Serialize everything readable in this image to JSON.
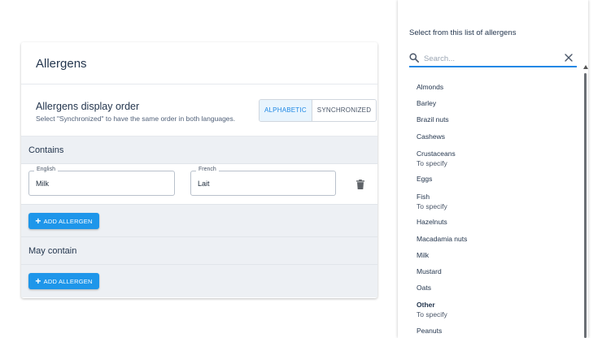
{
  "card": {
    "title": "Allergens",
    "display_order": {
      "title": "Allergens display order",
      "subtitle": "Select \"Synchronized\" to have the same order in both languages.",
      "options": [
        "ALPHABETIC",
        "SYNCHRONIZED"
      ],
      "selected": "ALPHABETIC"
    },
    "contains": {
      "label": "Contains",
      "rows": [
        {
          "en_label": "English",
          "en_value": "Milk",
          "fr_label": "French",
          "fr_value": "Lait"
        }
      ],
      "add_label": "ADD ALLERGEN"
    },
    "may_contain": {
      "label": "May contain",
      "add_label": "ADD ALLERGEN"
    }
  },
  "panel": {
    "title": "Select from this list of allergens",
    "search": {
      "placeholder": "Search...",
      "value": ""
    },
    "items": [
      {
        "name": "Almonds",
        "sub": ""
      },
      {
        "name": "Barley",
        "sub": ""
      },
      {
        "name": "Brazil nuts",
        "sub": ""
      },
      {
        "name": "Cashews",
        "sub": ""
      },
      {
        "name": "Crustaceans",
        "sub": "To specify"
      },
      {
        "name": "Eggs",
        "sub": ""
      },
      {
        "name": "Fish",
        "sub": "To specify"
      },
      {
        "name": "Hazelnuts",
        "sub": ""
      },
      {
        "name": "Macadamia nuts",
        "sub": ""
      },
      {
        "name": "Milk",
        "sub": ""
      },
      {
        "name": "Mustard",
        "sub": ""
      },
      {
        "name": "Oats",
        "sub": ""
      },
      {
        "name": "Other",
        "sub": "To specify"
      },
      {
        "name": "Peanuts",
        "sub": ""
      }
    ]
  },
  "icons": {
    "search": "search-icon",
    "close": "close-icon",
    "trash": "trash-icon",
    "add": "plus-icon"
  },
  "colors": {
    "accent": "#1e96ea",
    "section_bg": "#edf0f4",
    "active_toggle_bg": "#e8f4fd"
  }
}
